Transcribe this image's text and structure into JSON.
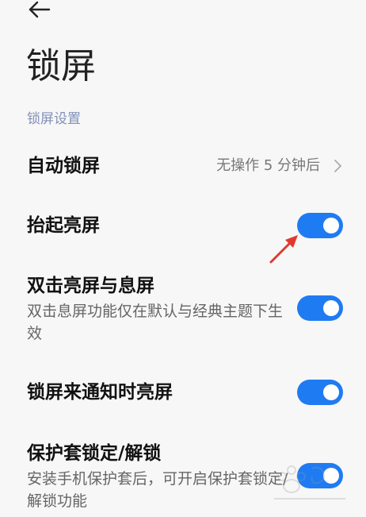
{
  "page": {
    "title": "锁屏",
    "section_header": "锁屏设置"
  },
  "rows": [
    {
      "title": "自动锁屏",
      "value": "无操作 5 分钟后"
    },
    {
      "title": "抬起亮屏",
      "enabled": true
    },
    {
      "title": "双击亮屏与息屏",
      "subtitle": "双击息屏功能仅在默认与经典主题下生效",
      "enabled": true
    },
    {
      "title": "锁屏来通知时亮屏",
      "enabled": true
    },
    {
      "title": "保护套锁定/解锁",
      "subtitle": "安装手机保护套后，可开启保护套锁定/解锁功能",
      "enabled": true
    }
  ],
  "colors": {
    "toggle_on": "#1f7bf2",
    "annotation_arrow": "#e03a2f",
    "section_header": "#8290b8"
  },
  "icons": {
    "back": "back-arrow-icon",
    "chevron": "chevron-right-icon"
  }
}
